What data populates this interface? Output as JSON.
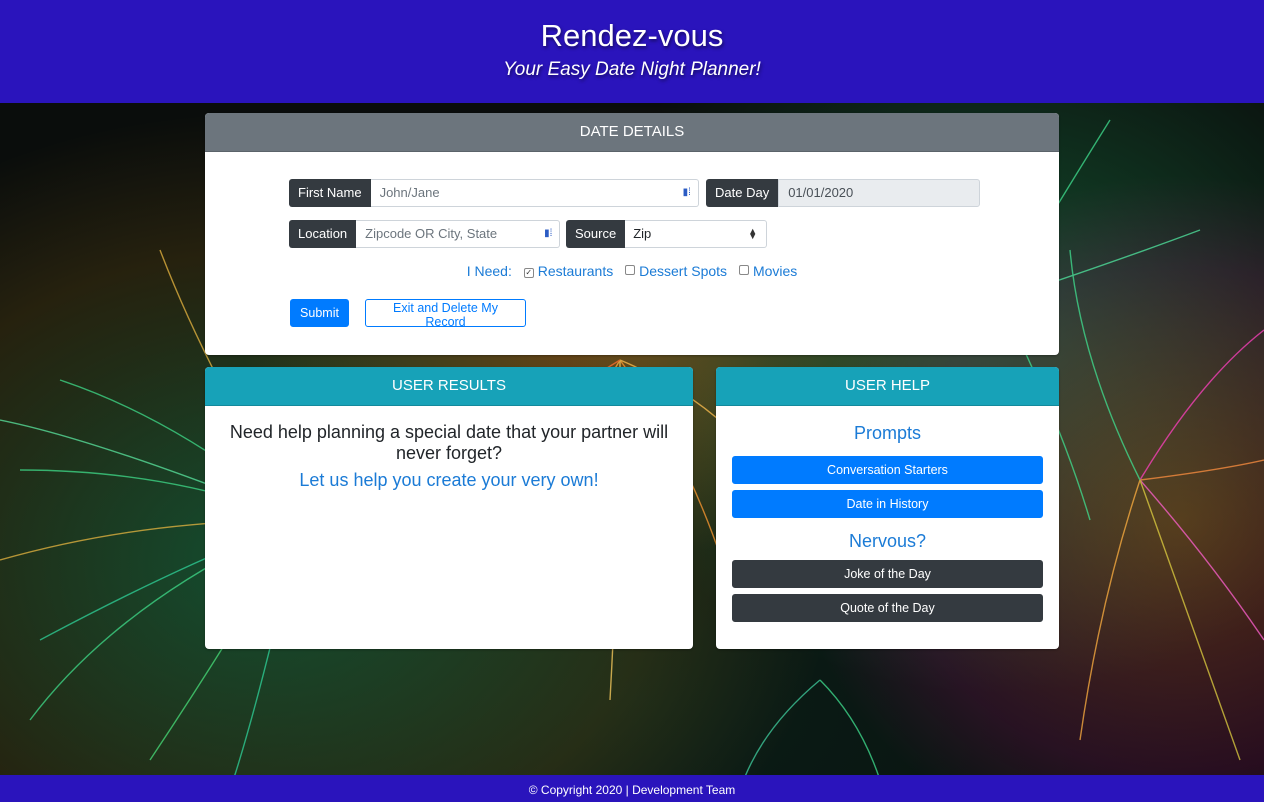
{
  "header": {
    "title": "Rendez-vous",
    "subtitle": "Your Easy Date Night Planner!"
  },
  "date_details": {
    "heading": "DATE DETAILS",
    "first_name_label": "First Name",
    "first_name_placeholder": "John/Jane",
    "date_day_label": "Date Day",
    "date_day_value": "01/01/2020",
    "location_label": "Location",
    "location_placeholder": "Zipcode OR City, State",
    "source_label": "Source",
    "source_selected": "Zip",
    "need_label": "I Need:",
    "options": [
      {
        "label": "Restaurants",
        "checked": true
      },
      {
        "label": "Dessert Spots",
        "checked": false
      },
      {
        "label": "Movies",
        "checked": false
      }
    ],
    "submit_label": "Submit",
    "exit_label": "Exit and Delete My Record"
  },
  "user_results": {
    "heading": "USER RESULTS",
    "lead": "Need help planning a special date that your partner will never forget?",
    "cta": "Let us help you create your very own!"
  },
  "user_help": {
    "heading": "USER HELP",
    "prompts_title": "Prompts",
    "conversation_starters": "Conversation Starters",
    "date_in_history": "Date in History",
    "nervous_title": "Nervous?",
    "joke_of_the_day": "Joke of the Day",
    "quote_of_the_day": "Quote of the Day"
  },
  "footer": {
    "text": "© Copyright 2020 | Development Team"
  },
  "colors": {
    "header_bg": "#2a14bc",
    "primary": "#007bff",
    "dark": "#343a40",
    "teal": "#17a2b8",
    "gray": "#6c757d"
  }
}
